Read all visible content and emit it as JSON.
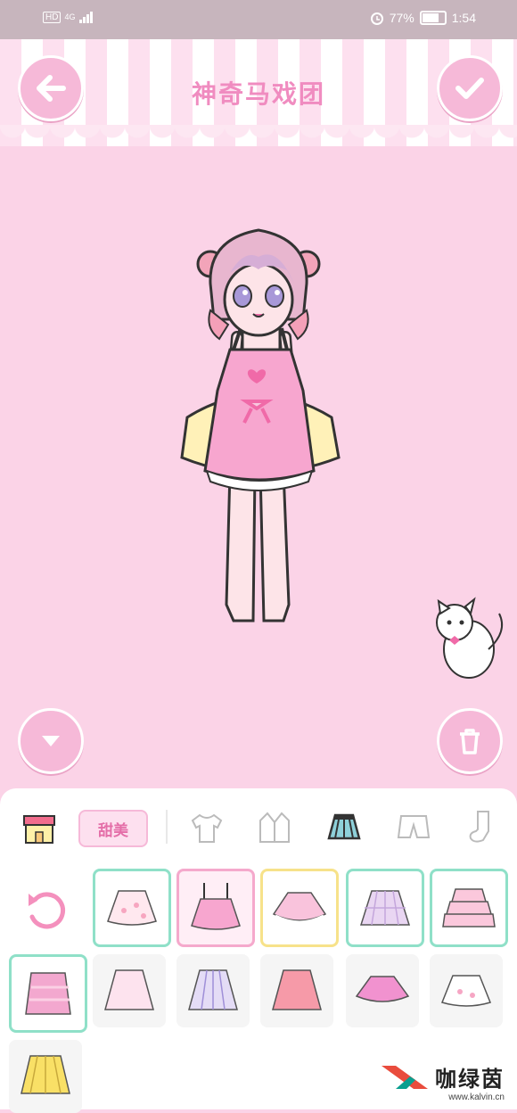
{
  "status_bar": {
    "hd": "HD",
    "network": "4G",
    "battery_text": "77%",
    "time": "1:54"
  },
  "header": {
    "title": "神奇马戏团"
  },
  "panel": {
    "style_chip": "甜美",
    "tabs": [
      "shop-icon",
      "shirt-icon",
      "jacket-icon",
      "skirt-icon",
      "shorts-icon",
      "sock-icon"
    ],
    "selected_tab": "skirt-icon"
  },
  "colors": {
    "accent": "#f6b9d8",
    "background": "#fbd3e7",
    "title": "#f08cc0"
  },
  "watermark": {
    "cn": "咖绿茵",
    "url": "www.kalvin.cn"
  }
}
